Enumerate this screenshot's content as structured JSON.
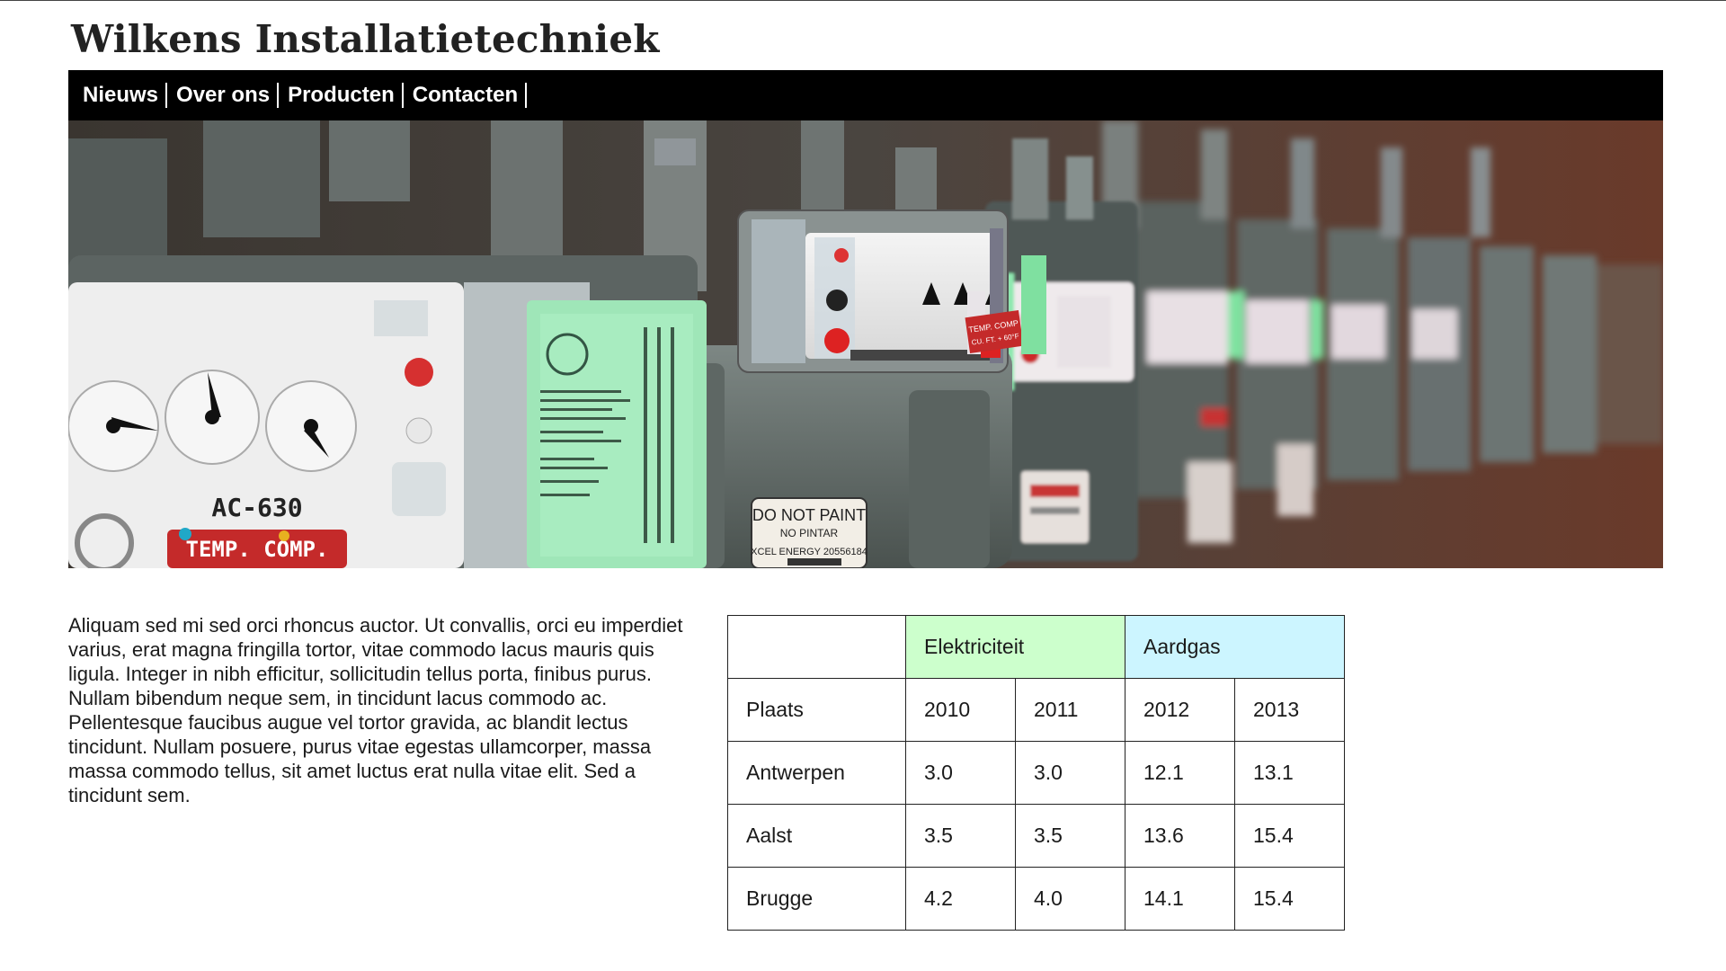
{
  "site": {
    "title": "Wilkens Installatietechniek"
  },
  "nav": {
    "items": [
      {
        "label": "Nieuws"
      },
      {
        "label": "Over ons"
      },
      {
        "label": "Producten"
      },
      {
        "label": "Contacten"
      }
    ]
  },
  "hero": {
    "meter_labels": {
      "model": "AC-630",
      "temp_comp": "TEMP. COMP.",
      "do_not_paint": "DO NOT PAINT",
      "no_pintar": "NO PINTAR",
      "serial": "XCEL ENERGY  20556184",
      "small_temp": "TEMP. COMP",
      "small_cuft": "CU. FT. + 60°F"
    }
  },
  "intro": {
    "text": "Aliquam sed mi sed orci rhoncus auctor. Ut convallis, orci eu imperdiet varius, erat magna fringilla tortor, vitae commodo lacus mauris quis ligula. Integer in nibh efficitur, sollicitudin tellus porta, finibus purus. Nullam bibendum neque sem, in tincidunt lacus commodo ac. Pellentesque faucibus augue vel tortor gravida, ac blandit lectus tincidunt. Nullam posuere, purus vitae egestas ullamcorper, massa massa commodo tellus, sit amet luctus erat nulla vitae elit. Sed a tincidunt sem."
  },
  "table": {
    "group_headers": {
      "electricity": "Elektriciteit",
      "gas": "Aardgas"
    },
    "colors": {
      "electricity": "#ccffcc",
      "gas": "#ccf5ff"
    },
    "header_row": {
      "place": "Plaats",
      "years": [
        "2010",
        "2011",
        "2012",
        "2013"
      ]
    },
    "rows": [
      {
        "place": "Antwerpen",
        "values": [
          "3.0",
          "3.0",
          "12.1",
          "13.1"
        ]
      },
      {
        "place": "Aalst",
        "values": [
          "3.5",
          "3.5",
          "13.6",
          "15.4"
        ]
      },
      {
        "place": "Brugge",
        "values": [
          "4.2",
          "4.0",
          "14.1",
          "15.4"
        ]
      }
    ]
  }
}
